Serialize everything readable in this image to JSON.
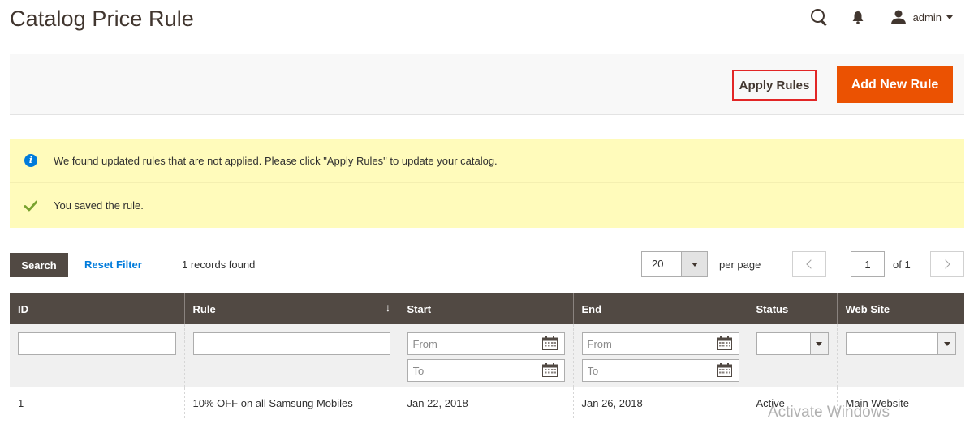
{
  "page": {
    "title": "Catalog Price Rule"
  },
  "header": {
    "user_name": "admin"
  },
  "actions": {
    "apply_rules_label": "Apply Rules",
    "add_new_rule_label": "Add New Rule"
  },
  "messages": {
    "info": "We found updated rules that are not applied. Please click \"Apply Rules\" to update your catalog.",
    "success": "You saved the rule."
  },
  "grid_controls": {
    "search_label": "Search",
    "reset_filter_label": "Reset Filter",
    "records_found": "1 records found",
    "per_page_value": "20",
    "per_page_label": "per page",
    "current_page": "1",
    "page_of": "of 1"
  },
  "table": {
    "columns": [
      "ID",
      "Rule",
      "Start",
      "End",
      "Status",
      "Web Site"
    ],
    "sort_indicator": "↓",
    "filters": {
      "date_from_placeholder": "From",
      "date_to_placeholder": "To"
    },
    "rows": [
      {
        "id": "1",
        "rule": "10% OFF on all Samsung Mobiles",
        "start": "Jan 22, 2018",
        "end": "Jan 26, 2018",
        "status": "Active",
        "website": "Main Website"
      }
    ]
  },
  "watermark": "Activate Windows",
  "colors": {
    "accent": "#eb5202",
    "header_dark": "#514943",
    "link": "#007bdb",
    "message_bg": "#fffbbb",
    "highlight_border": "#e22626"
  }
}
